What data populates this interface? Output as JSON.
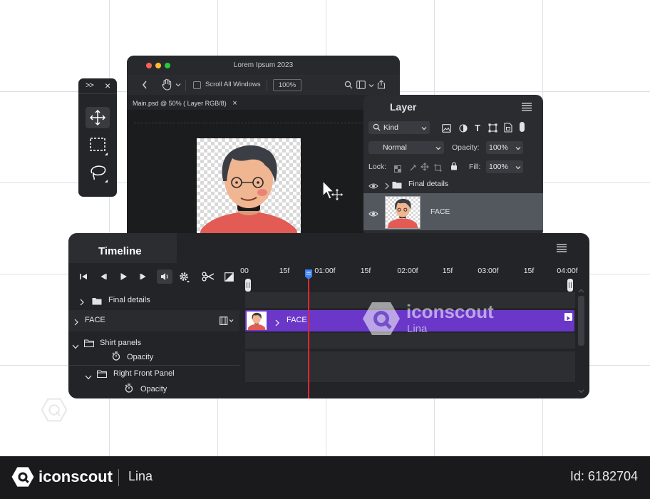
{
  "main_window": {
    "title": "Lorem Ipsum 2023",
    "traffic_colors": [
      "#ff5f57",
      "#febc2e",
      "#28c840"
    ],
    "toolbar": {
      "scroll_all_label": "Scroll All Windows",
      "zoom_value": "100%"
    },
    "document_tab": {
      "label": "Main.psd @ 50% ( Layer RGB/8)",
      "close": "×"
    }
  },
  "tools_panel": {
    "expand_glyph": ">>",
    "close_glyph": "×",
    "tools": [
      {
        "name": "move",
        "icon": "move-icon"
      },
      {
        "name": "marquee",
        "icon": "marquee-icon"
      },
      {
        "name": "lasso",
        "icon": "lasso-icon"
      }
    ]
  },
  "layer_panel": {
    "title": "Layer",
    "kind_label": "Kind",
    "blend_mode": "Normal",
    "opacity_label": "Opacity:",
    "opacity_value": "100%",
    "lock_label": "Lock:",
    "fill_label": "Fill:",
    "fill_value": "100%",
    "layers": [
      {
        "name": "Final details",
        "type": "group"
      },
      {
        "name": "FACE",
        "type": "layer",
        "selected": true
      }
    ]
  },
  "timeline": {
    "title": "Timeline",
    "ruler_labels": [
      "00",
      "15f",
      "01:00f",
      "15f",
      "02:00f",
      "15f",
      "03:00f",
      "15f",
      "04:00f"
    ],
    "rows": [
      {
        "label": "Final details",
        "type": "group"
      },
      {
        "label": "FACE",
        "type": "layer"
      },
      {
        "label": "Shirt panels",
        "type": "group",
        "expanded": true
      },
      {
        "label": "Opacity",
        "type": "property"
      },
      {
        "label": "Right Front Panel",
        "type": "group",
        "expanded": true
      },
      {
        "label": "Opacity",
        "type": "property"
      }
    ],
    "clip": {
      "label": "FACE",
      "color": "#6a37c9"
    },
    "watermark": {
      "brand": "iconscout",
      "author": "Lina"
    }
  },
  "footer": {
    "brand": "iconscout",
    "author": "Lina",
    "asset_id": "Id: 6182704"
  }
}
